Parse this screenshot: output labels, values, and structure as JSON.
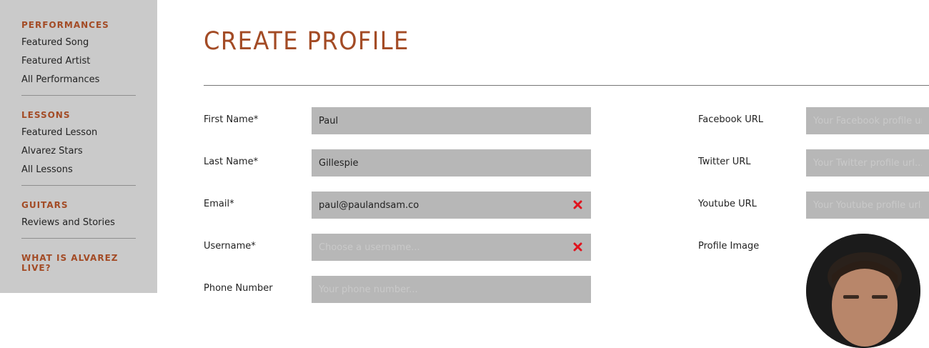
{
  "sidebar": {
    "sections": [
      {
        "heading": "PERFORMANCES",
        "items": [
          "Featured Song",
          "Featured Artist",
          "All Performances"
        ]
      },
      {
        "heading": "LESSONS",
        "items": [
          "Featured Lesson",
          "Alvarez Stars",
          "All Lessons"
        ]
      },
      {
        "heading": "GUITARS",
        "items": [
          "Reviews and Stories"
        ]
      },
      {
        "heading": "WHAT IS ALVAREZ LIVE?",
        "items": []
      }
    ]
  },
  "page": {
    "title": "CREATE PROFILE"
  },
  "form": {
    "first_name": {
      "label": "First Name*",
      "value": "Paul",
      "placeholder": ""
    },
    "last_name": {
      "label": "Last Name*",
      "value": "Gillespie",
      "placeholder": ""
    },
    "email": {
      "label": "Email*",
      "value": "paul@paulandsam.co",
      "placeholder": "",
      "error_icon": "close-icon"
    },
    "username": {
      "label": "Username*",
      "value": "",
      "placeholder": "Choose a username...",
      "error_icon": "close-icon"
    },
    "phone": {
      "label": "Phone Number",
      "value": "",
      "placeholder": "Your phone number..."
    },
    "facebook": {
      "label": "Facebook URL",
      "value": "",
      "placeholder": "Your Facebook profile url..."
    },
    "twitter": {
      "label": "Twitter URL",
      "value": "",
      "placeholder": "Your Twitter profile url..."
    },
    "youtube": {
      "label": "Youtube URL",
      "value": "",
      "placeholder": "Your Youtube profile url..."
    },
    "profile_image": {
      "label": "Profile Image"
    }
  },
  "colors": {
    "accent": "#a34b25",
    "sidebar_bg": "#cacaca",
    "field_bg": "#b7b7b7",
    "error": "#e0141e"
  }
}
